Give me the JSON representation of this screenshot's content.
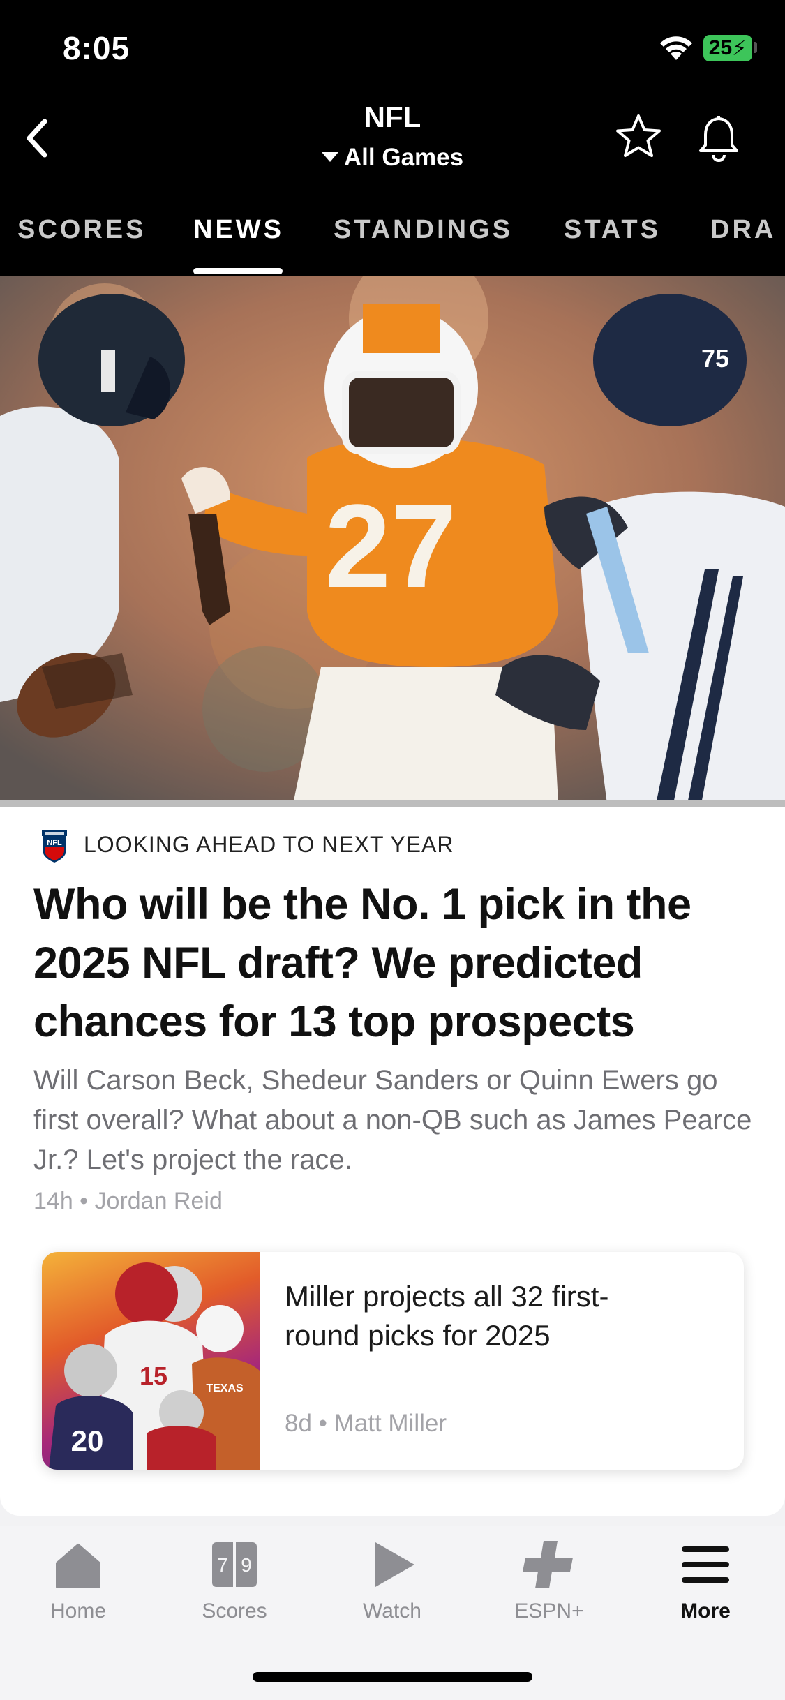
{
  "status_bar": {
    "time": "8:05",
    "battery": "25"
  },
  "nav": {
    "title": "NFL",
    "subtitle": "All Games"
  },
  "tabs": [
    {
      "label": "SCORES"
    },
    {
      "label": "NEWS"
    },
    {
      "label": "STANDINGS"
    },
    {
      "label": "STATS"
    },
    {
      "label": "DRA"
    }
  ],
  "active_tab": "NEWS",
  "article": {
    "kicker": "LOOKING AHEAD TO NEXT YEAR",
    "headline": "Who will be the No. 1 pick in the 2025 NFL draft? We predicted chances for 13 top prospects",
    "dek": "Will Carson Beck, Shedeur Sanders or Quinn Ewers go first overall? What about a non-QB such as James Pearce Jr.? Let's project the race.",
    "byline": "14h • Jordan Reid",
    "hero_jersey_number": "27"
  },
  "related": {
    "title": "Miller projects all 32 first-round picks for 2025",
    "byline": "8d • Matt Miller"
  },
  "tabbar": {
    "items": [
      {
        "label": "Home",
        "icon": "home-icon"
      },
      {
        "label": "Scores",
        "icon": "scoreboard-icon"
      },
      {
        "label": "Watch",
        "icon": "play-icon"
      },
      {
        "label": "ESPN+",
        "icon": "plus-icon"
      },
      {
        "label": "More",
        "icon": "menu-icon"
      }
    ],
    "active": "More"
  },
  "colors": {
    "accent_battery": "#3dc55a",
    "top_bar": "#000000",
    "jersey_orange": "#ef8a1e"
  }
}
